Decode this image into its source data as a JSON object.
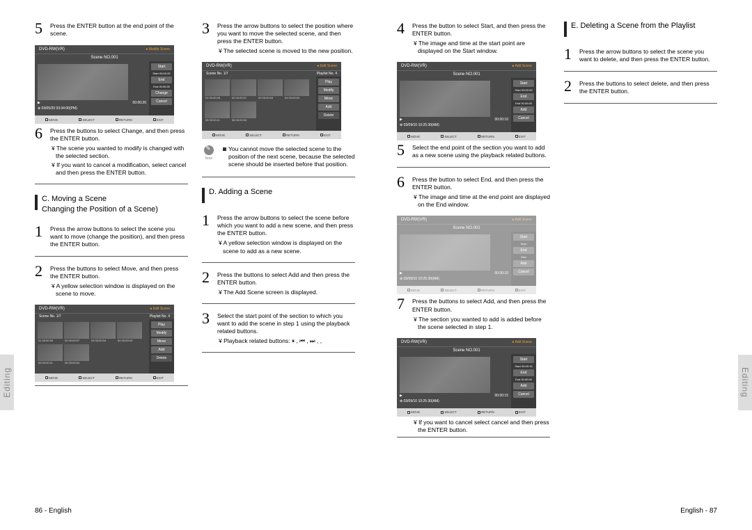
{
  "sidetab": "Editing",
  "footer_left": "86 - English",
  "footer_right": "English - 87",
  "sections": {
    "C": {
      "title": "C. Moving a Scene\nChanging the Position of a Scene)"
    },
    "D": {
      "title": "D. Adding a Scene"
    },
    "E": {
      "title": "E. Deleting a Scene from the Playlist"
    }
  },
  "left": {
    "col1": {
      "s5": "Press the ENTER button at the end point of the scene.",
      "s6": {
        "t": "Press the         buttons to select Change, and then press the ENTER button.",
        "b1": "¥ The scene you wanted to modify is changed with the selected section.",
        "b2": "¥ If you want to cancel a modification, select cancel and then press the ENTER button."
      },
      "C_s1": "Press the arrow buttons to select the scene you want to move (change the position), and then press the ENTER button.",
      "C_s2": {
        "t": "Press the         buttons to select Move, and then press the ENTER button.",
        "b1": "¥ A yellow selection window is displayed on the scene to move."
      }
    },
    "col2": {
      "s3": {
        "t": "Press the arrow buttons to select the position where you want to move the selected scene, and then press the ENTER button.",
        "b1": "¥ The selected scene is moved to the new position."
      },
      "note": "You cannot move the selected scene to the position of the next scene, because the selected scene should be inserted before that position.",
      "D_s1": "Press the arrow buttons to select the scene before which you want to add a new scene, and then press the ENTER button.",
      "D_s1_b1": "¥ A yellow selection window is displayed on the scene to add as a new scene.",
      "D_s2": {
        "t": "Press the         buttons to select Add and then press the ENTER button.",
        "b1": "¥ The Add Scene screen is displayed."
      },
      "D_s3": {
        "t": "Select the start point of the section to which you want to add the scene in step 1 using the playback related buttons.",
        "b1": "¥ Playback related buttons:  ⏸ , ⏮ , ⏭ ,     ,"
      }
    }
  },
  "right": {
    "col1": {
      "s4": {
        "t": "Press the         button to select Start, and then press the ENTER button.",
        "b1": "¥ The image and time at the start point are displayed on the Start window."
      },
      "s5": "Select the end point of the section you want to add as a new scene using the playback related buttons.",
      "s6": {
        "t": "Press the         button to select End, and then press the ENTER button.",
        "b1": "¥ The image and time at the end point are displayed on the End window."
      },
      "s7": {
        "t": "Press the         buttons to select Add, and then press the ENTER button.",
        "b1": "¥ The section you wanted to add is added before the scene selected in step 1.",
        "b2": "¥ If you want to cancel select cancel and then press the ENTER button."
      }
    },
    "col2": {
      "E_s1": "Press the arrow buttons to select the scene you want to delete, and then press the ENTER button.",
      "E_s2": "Press the         buttons to select delete, and then press the ENTER button."
    }
  },
  "screens": {
    "modify": {
      "top_l": "DVD-RW(VR)",
      "top_r": "Modify Scene",
      "title": "Scene NO.001",
      "btns": [
        "Start",
        "End",
        "Change",
        "Cancel"
      ],
      "start": "Start   00:00:25",
      "end": "End   00:00:00",
      "t1": "00:00:20",
      "t2": "03/05/20 03:34:00(PM)",
      "nav": [
        "MOVE",
        "SELECT",
        "RETURN",
        "EXIT"
      ]
    },
    "edit": {
      "top_l": "DVD-RW(VR)",
      "top_r": "Edit Scene",
      "sub_l": "Scene No.   1/7",
      "sub_r": "Playlist No.   4",
      "btns": [
        "Play",
        "Modify",
        "Move",
        "Add",
        "Delete"
      ],
      "thumbs": [
        "01  00:00:26",
        "02  00:00:07",
        "03  00:00:04",
        "04  00:00:03",
        "05  00:00:11",
        "06  00:00:04"
      ],
      "nav": [
        "MOVE",
        "SELECT",
        "RETURN",
        "EXIT"
      ]
    },
    "add": {
      "top_l": "DVD-RW(VR)",
      "top_r": "Add Scene",
      "title": "Scene NO.001",
      "btns": [
        "Start",
        "End",
        "Add",
        "Cancel"
      ],
      "start": "Start   00:00:00",
      "end": "End   00:00:00",
      "t1": "00:00:10",
      "t2": "03/09/10 10:25:30(AM)",
      "start2": "Start   00:00:15",
      "nav": [
        "MOVE",
        "SELECT",
        "RETURN",
        "EXIT"
      ]
    }
  }
}
